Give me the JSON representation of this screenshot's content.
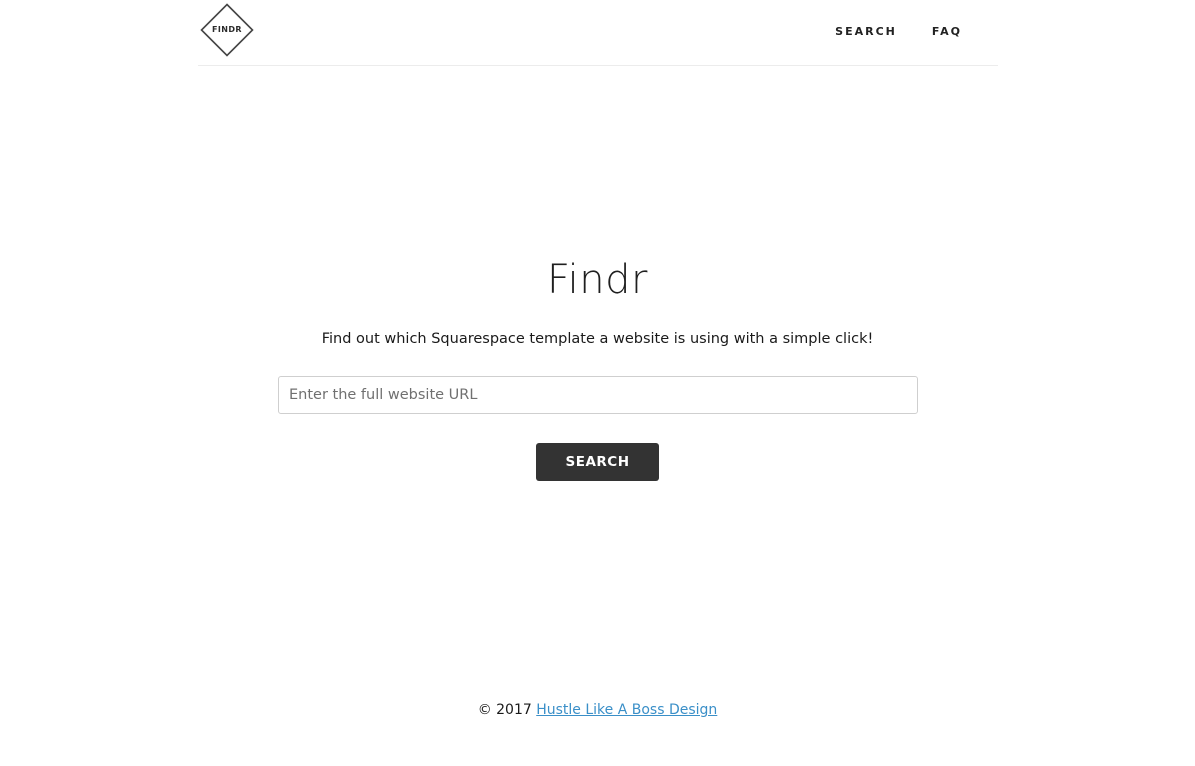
{
  "header": {
    "logo": {
      "text": "FINDR",
      "icon": "diamond-logo-icon"
    },
    "nav": [
      {
        "label": "SEARCH"
      },
      {
        "label": "FAQ"
      }
    ]
  },
  "hero": {
    "title": "Findr",
    "subtitle": "Find out which Squarespace template a website is using with a simple click!",
    "input": {
      "placeholder": "Enter the full website URL",
      "value": ""
    },
    "button_label": "SEARCH"
  },
  "footer": {
    "copyright": "© 2017",
    "link_text": "Hustle Like A Boss Design"
  },
  "colors": {
    "background": "#ffffff",
    "button": "#333333",
    "link": "#3a8fc8",
    "divider": "#ececec"
  }
}
